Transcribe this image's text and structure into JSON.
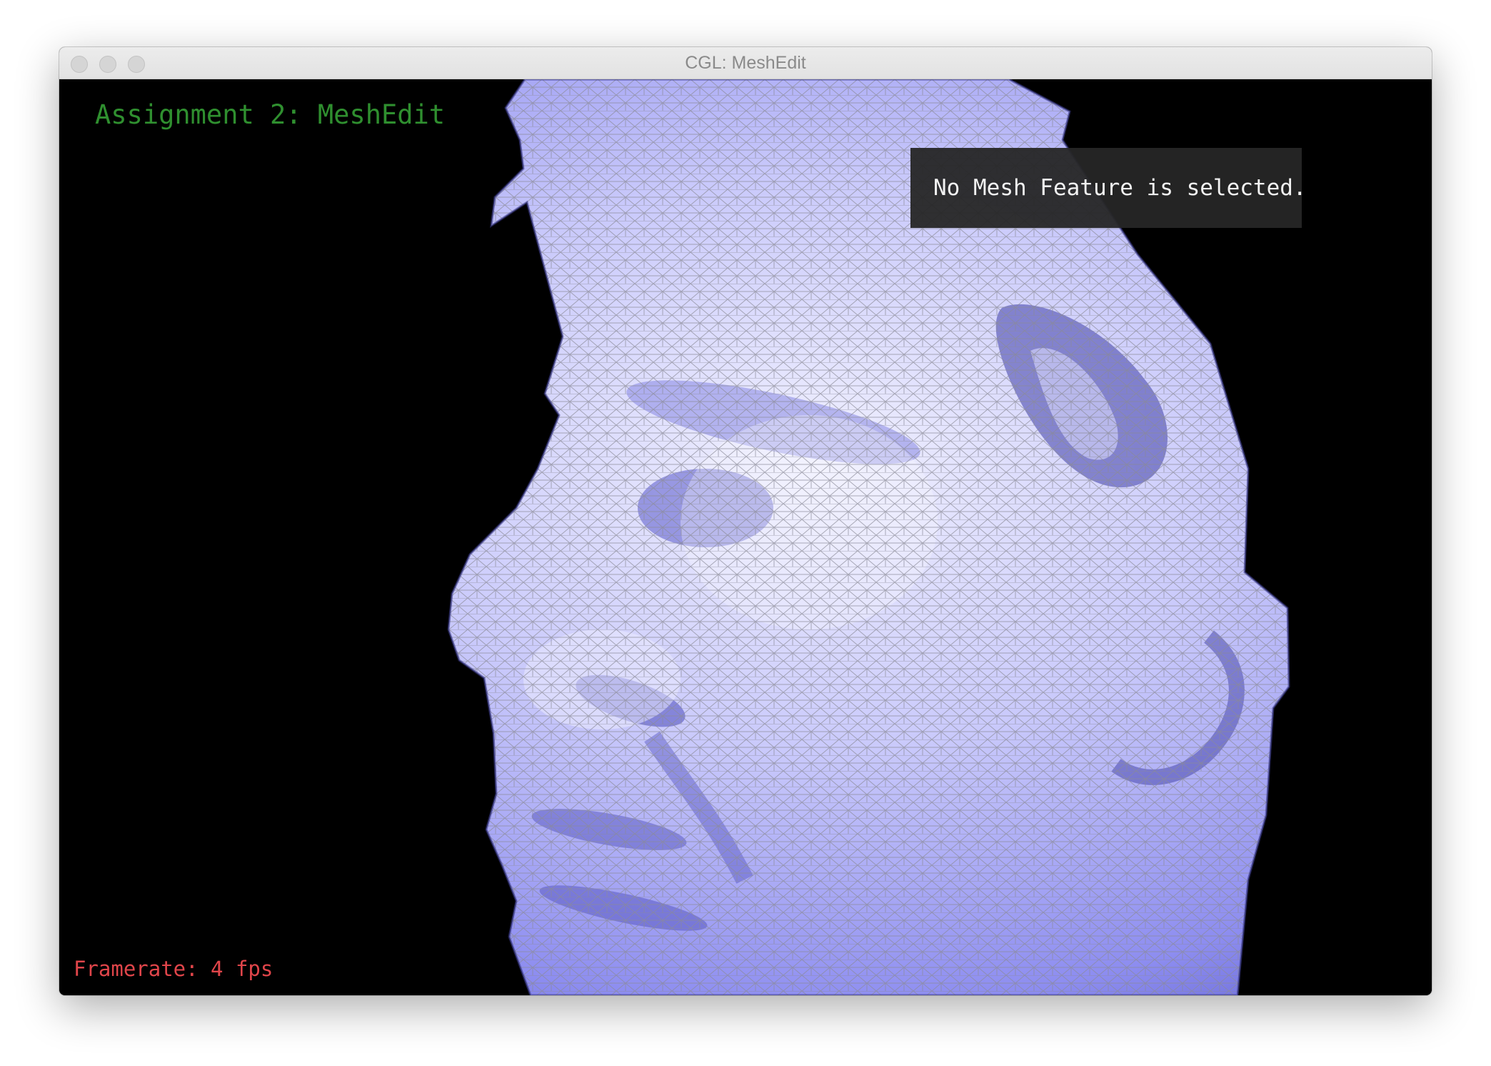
{
  "window": {
    "title": "CGL: MeshEdit"
  },
  "overlay": {
    "assignment_title": "Assignment 2: MeshEdit",
    "selection_info": "No Mesh Feature is selected.",
    "framerate": "Framerate: 4 fps"
  },
  "colors": {
    "background": "#000000",
    "mesh_fill": "#a9a9f5",
    "mesh_wire": "#8e8e99",
    "title_green": "#2f8f2f",
    "framerate_red": "#e0454a"
  }
}
